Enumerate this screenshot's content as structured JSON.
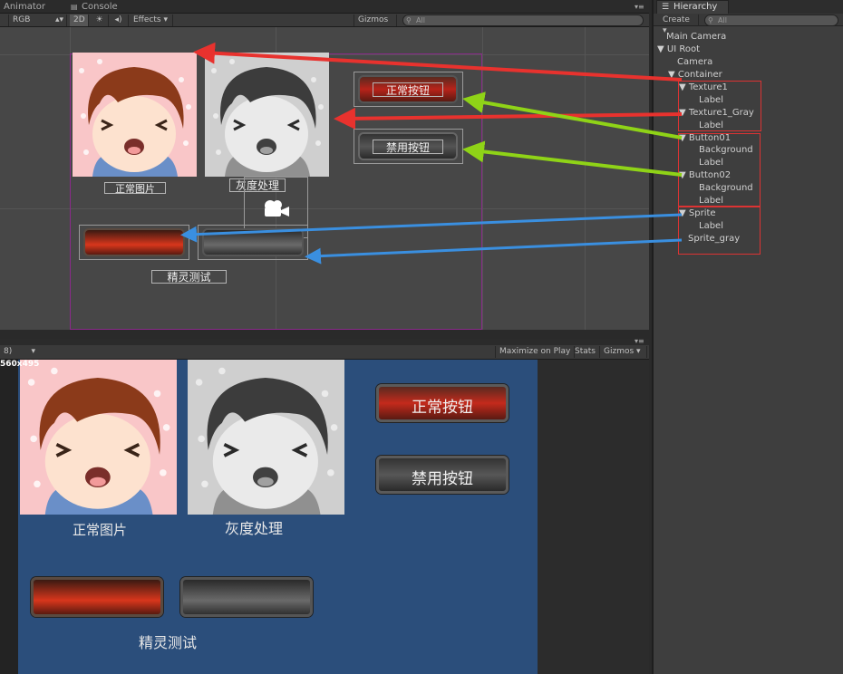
{
  "tabs": {
    "animator": "Animator",
    "console": "Console"
  },
  "scene_toolbar": {
    "rgb": "RGB",
    "mode_2d": "2D",
    "effects": "Effects",
    "gizmos": "Gizmos",
    "search_placeholder": "All"
  },
  "game_toolbar": {
    "aspect": "8)",
    "resolution": "560x495",
    "maximize": "Maximize on Play",
    "stats": "Stats",
    "gizmos": "Gizmos"
  },
  "hierarchy": {
    "tab": "Hierarchy",
    "create": "Create",
    "search_placeholder": "All",
    "items": [
      {
        "label": "Main Camera"
      },
      {
        "label": "UI Root"
      },
      {
        "label": "Camera"
      },
      {
        "label": "Container"
      },
      {
        "label": "Texture1"
      },
      {
        "label": "Label"
      },
      {
        "label": "Texture1_Gray"
      },
      {
        "label": "Label"
      },
      {
        "label": "Button01"
      },
      {
        "label": "Background"
      },
      {
        "label": "Label"
      },
      {
        "label": "Button02"
      },
      {
        "label": "Background"
      },
      {
        "label": "Label"
      },
      {
        "label": "Sprite"
      },
      {
        "label": "Label"
      },
      {
        "label": "Sprite_gray"
      }
    ]
  },
  "scene": {
    "normal_button": "正常按钮",
    "disabled_button": "禁用按钮",
    "normal_image": "正常图片",
    "gray_image": "灰度处理",
    "sprite_test": "精灵测试"
  },
  "game": {
    "normal_button": "正常按钮",
    "disabled_button": "禁用按钮",
    "normal_image": "正常图片",
    "gray_image": "灰度处理",
    "sprite_test": "精灵测试"
  },
  "colors": {
    "arrow_red": "#e8322e",
    "arrow_green": "#8fd317",
    "arrow_blue": "#3a8fe0",
    "game_bg": "#2b4e7b",
    "scene_bg": "#474747"
  }
}
